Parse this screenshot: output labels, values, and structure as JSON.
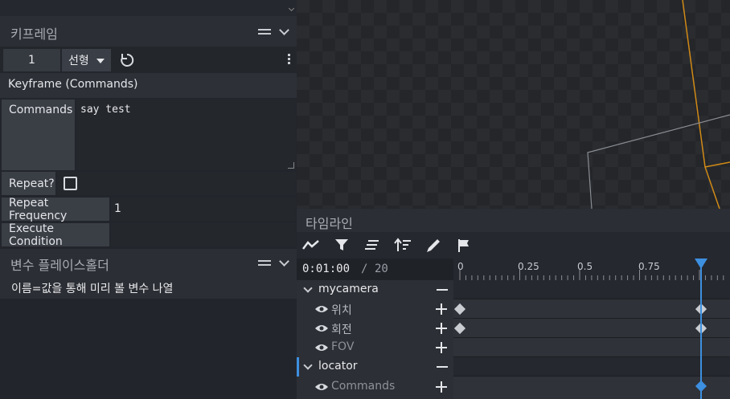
{
  "keyframe_panel": {
    "title": "키프레임",
    "frame_number": "1",
    "interpolation": "선형",
    "section_title": "Keyframe (Commands)",
    "commands_label": "Commands",
    "commands_value": "say test",
    "repeat_label": "Repeat?",
    "repeat_checked": false,
    "repeat_frequency_label": "Repeat Frequency",
    "repeat_frequency_value": "1",
    "execute_condition_label": "Execute Condition",
    "execute_condition_value": ""
  },
  "variable_panel": {
    "title": "변수 플레이스홀더",
    "description": "이름=값을 통해 미리 볼 변수 나열"
  },
  "timeline": {
    "title": "타임라인",
    "current_time": "0:01:00",
    "separator": "/",
    "total": "20",
    "ticks": [
      "0",
      "0.25",
      "0.5",
      "0.75"
    ],
    "groups": [
      {
        "name": "mycamera",
        "channels": [
          "위치",
          "회전",
          "FOV"
        ]
      },
      {
        "name": "locator",
        "channels": [
          "Commands"
        ]
      }
    ],
    "accent_color": "#3d8fe0",
    "toolbar_icons": [
      "graph-icon",
      "filter-icon",
      "align-icon",
      "sort-icon",
      "pen-icon",
      "flag-icon"
    ]
  }
}
